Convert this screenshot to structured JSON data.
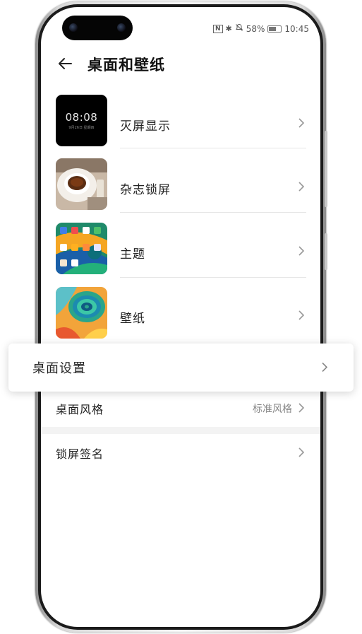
{
  "status_bar": {
    "nfc": "N",
    "bluetooth": "✱",
    "mute": "🔕",
    "battery_percent": "58%",
    "time": "10:45"
  },
  "header": {
    "title": "桌面和壁纸",
    "back_icon": "back-arrow-icon"
  },
  "items": [
    {
      "label": "灭屏显示",
      "thumb_time": "08:08",
      "thumb_date": "9月26日 星期四",
      "icon": "aod-preview"
    },
    {
      "label": "杂志锁屏",
      "icon": "coffee-photo"
    },
    {
      "label": "主题",
      "icon": "theme-preview"
    },
    {
      "label": "壁纸",
      "icon": "wallpaper-preview"
    }
  ],
  "floating": {
    "label": "桌面设置"
  },
  "desktop_style": {
    "label": "桌面风格",
    "value": "标准风格"
  },
  "lock_signature": {
    "label": "锁屏签名"
  },
  "colors": {
    "accent": "#0a59f7",
    "text": "#222222",
    "secondary": "#888888"
  }
}
